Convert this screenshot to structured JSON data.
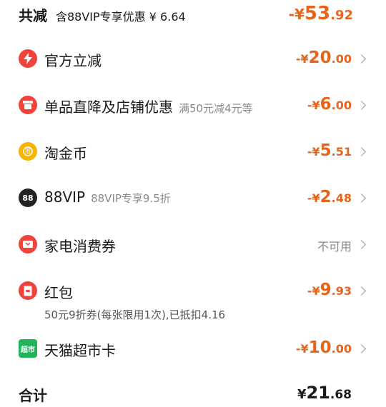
{
  "summary": {
    "title": "共减",
    "note_prefix": "含88VIP专享优惠",
    "note_amount": "¥ 6.64",
    "amount_sign": "-¥",
    "amount_int": "53",
    "amount_dec": ".92"
  },
  "items": [
    {
      "label": "官方立减",
      "sub": "",
      "sign": "-¥",
      "int": "20",
      "dec": ".00",
      "icon": "lightning-icon",
      "color": "#f0433a"
    },
    {
      "label": "单品直降及店铺优惠",
      "sub": "满50元减4元等",
      "sign": "-¥",
      "int": "6",
      "dec": ".00",
      "icon": "shop-icon",
      "color": "#f0433a"
    },
    {
      "label": "淘金币",
      "sub": "",
      "sign": "-¥",
      "int": "5",
      "dec": ".51",
      "icon": "coin-icon",
      "color": "#f5b400"
    },
    {
      "label": "88VIP",
      "sub": "88VIP专享9.5折",
      "sign": "-¥",
      "int": "2",
      "dec": ".48",
      "icon": "88vip-icon",
      "color": "#222222",
      "icon_text": "88"
    },
    {
      "label": "家电消费券",
      "sub": "",
      "status": "不可用",
      "icon": "coupon-icon",
      "color": "#f0433a"
    },
    {
      "label": "红包",
      "sub": "",
      "sign": "-¥",
      "int": "9",
      "dec": ".93",
      "icon": "redpacket-icon",
      "color": "#f0433a",
      "note": "50元9折券(每张限用1次),已抵扣4.16"
    },
    {
      "label": "天猫超市卡",
      "sub": "",
      "sign": "-¥",
      "int": "10",
      "dec": ".00",
      "icon": "supermarket-card-icon",
      "color": "#21b45b",
      "icon_text": "超市"
    }
  ],
  "total": {
    "label": "合计",
    "currency": "¥",
    "int": "21",
    "dec": ".68"
  }
}
